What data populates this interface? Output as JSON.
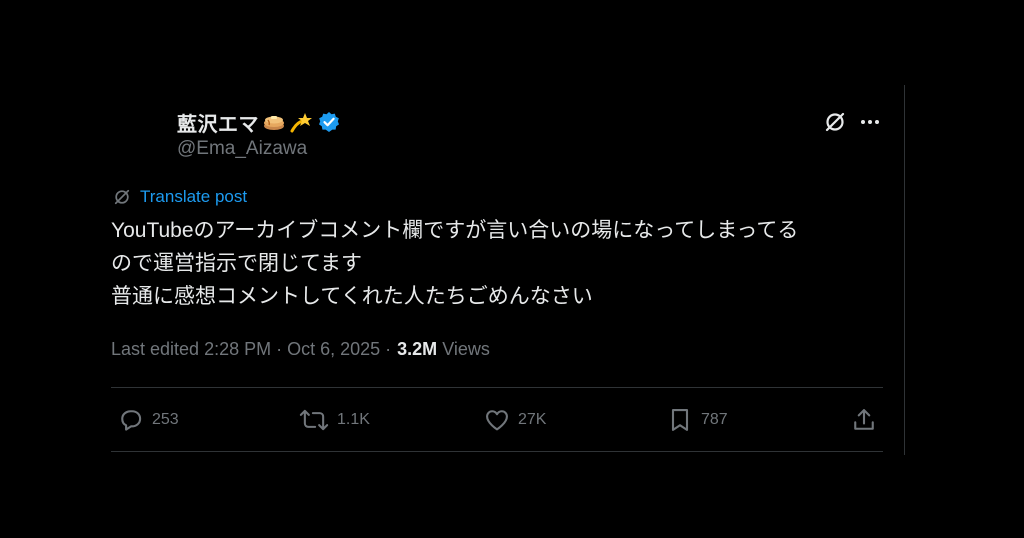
{
  "author": {
    "display_name": "藍沢エマ",
    "handle": "@Ema_Aizawa",
    "emoji_1": "pancake-emoji",
    "emoji_2": "dizzy-emoji",
    "verified": true
  },
  "header": {
    "grok_icon": "grok-icon",
    "more_icon": "more-icon"
  },
  "translate": {
    "label": "Translate post"
  },
  "post": {
    "text": "YouTubeのアーカイブコメント欄ですが言い合いの場になってしまってる\nので運営指示で閉じてます\n普通に感想コメントしてくれた人たちごめんなさい"
  },
  "meta": {
    "edited": "Last edited 2:28 PM · Oct 6, 2025 ·",
    "views_count": "3.2M",
    "views_label": "Views"
  },
  "actions": {
    "replies": "253",
    "reposts": "1.1K",
    "likes": "27K",
    "bookmarks": "787"
  },
  "colors": {
    "background": "#000000",
    "text": "#e7e9ea",
    "secondary": "#71767b",
    "accent": "#1d9bf0",
    "divider": "#2f3336"
  }
}
